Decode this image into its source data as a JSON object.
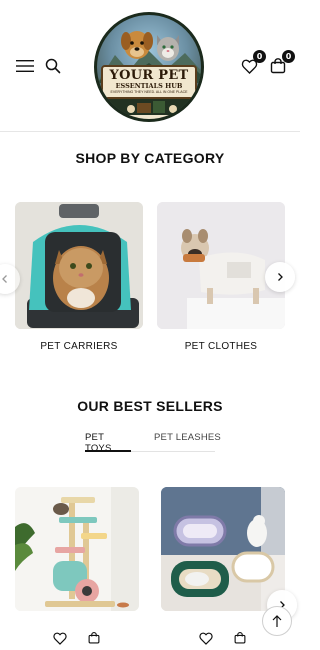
{
  "header": {
    "menu_icon": "hamburger-icon",
    "search_icon": "search-icon",
    "wishlist_icon": "heart-icon",
    "wishlist_count": "0",
    "cart_icon": "shopping-bag-icon",
    "cart_count": "0",
    "logo": {
      "title": "YOUR PET",
      "subtitle": "ESSENTIALS HUB",
      "tagline": "EVERYTHING THEY NEED. ALL IN ONE PLACE"
    }
  },
  "categories": {
    "title": "SHOP BY CATEGORY",
    "items": [
      {
        "label": "PET CARRIERS"
      },
      {
        "label": "PET CLOTHES"
      }
    ]
  },
  "best_sellers": {
    "title": "OUR BEST SELLERS",
    "tabs": [
      {
        "label": "PET TOYS",
        "active": true
      },
      {
        "label": "PET LEASHES",
        "active": false
      }
    ]
  },
  "colors": {
    "text": "#111111",
    "accent_teal": "#3fbfb9",
    "divider": "#e6e6e6"
  }
}
